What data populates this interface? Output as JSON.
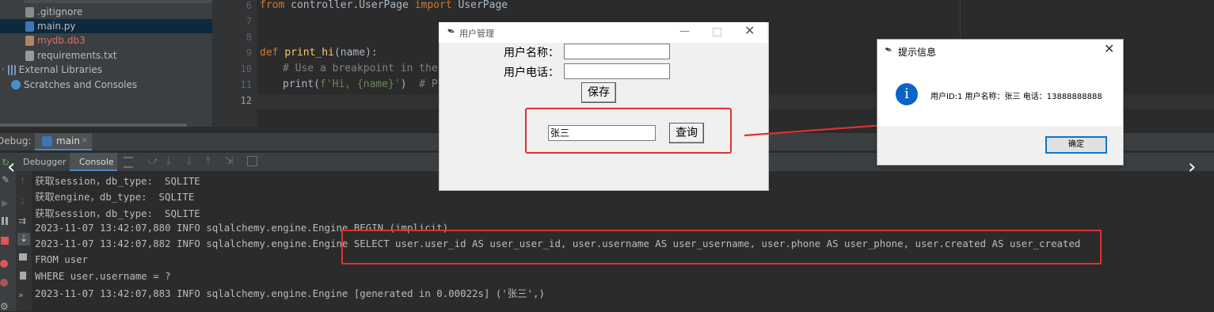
{
  "project_tree": {
    "items": [
      {
        "label": ".gitignore",
        "color": "#bbbbbb"
      },
      {
        "label": "main.py",
        "color": "#bbbbbb",
        "selected": true
      },
      {
        "label": "mydb.db3",
        "color": "#d5756c"
      },
      {
        "label": "requirements.txt",
        "color": "#bbbbbb"
      },
      {
        "label": "External Libraries",
        "color": "#bbbbbb"
      },
      {
        "label": "Scratches and Consoles",
        "color": "#bbbbbb"
      }
    ]
  },
  "editor": {
    "line_numbers": [
      "6",
      "7",
      "8",
      "9",
      "10",
      "11",
      "12"
    ],
    "line6_kw1": "from",
    "line6_mod": " controller.UserPage ",
    "line6_kw2": "import",
    "line6_name": " UserPage",
    "line9_kw": "def",
    "line9_fn": "print_hi",
    "line9_args": "(name):",
    "line10_comment": "# Use a breakpoint in the c",
    "line11_call": "print(",
    "line11_str": "f'Hi, {name}'",
    "line11_rest": ")  ",
    "line11_comment": "# Pre"
  },
  "debug": {
    "label": "Debug:",
    "run_tab": "main",
    "tabs": [
      "Debugger",
      "Console"
    ]
  },
  "console": {
    "lines": [
      "获取session，db_type:  SQLITE",
      "获取engine，db_type:  SQLITE",
      "获取session，db_type:  SQLITE",
      "2023-11-07 13:42:07,880 INFO sqlalchemy.engine.Engine BEGIN (implicit)",
      "2023-11-07 13:42:07,882 INFO sqlalchemy.engine.Engine SELECT user.user_id AS user_user_id, user.username AS user_username, user.phone AS user_phone, user.created AS user_created",
      "FROM user",
      "WHERE user.username = ?",
      "2023-11-07 13:42:07,883 INFO sqlalchemy.engine.Engine [generated in 0.00022s] ('张三',)"
    ]
  },
  "tk_window": {
    "title": "用户管理",
    "name_label": "用户名称：",
    "phone_label": "用户电话：",
    "name_value": "",
    "phone_value": "",
    "save_button": "保存",
    "query_value": "张三",
    "query_button": "查询"
  },
  "message_box": {
    "title": "提示信息",
    "message": "用户ID:1 用户名称：张三 电话：13888888888",
    "ok_button": "确定"
  },
  "colors": {
    "annotation_red": "#e03131",
    "info_blue": "#0a64c8"
  }
}
